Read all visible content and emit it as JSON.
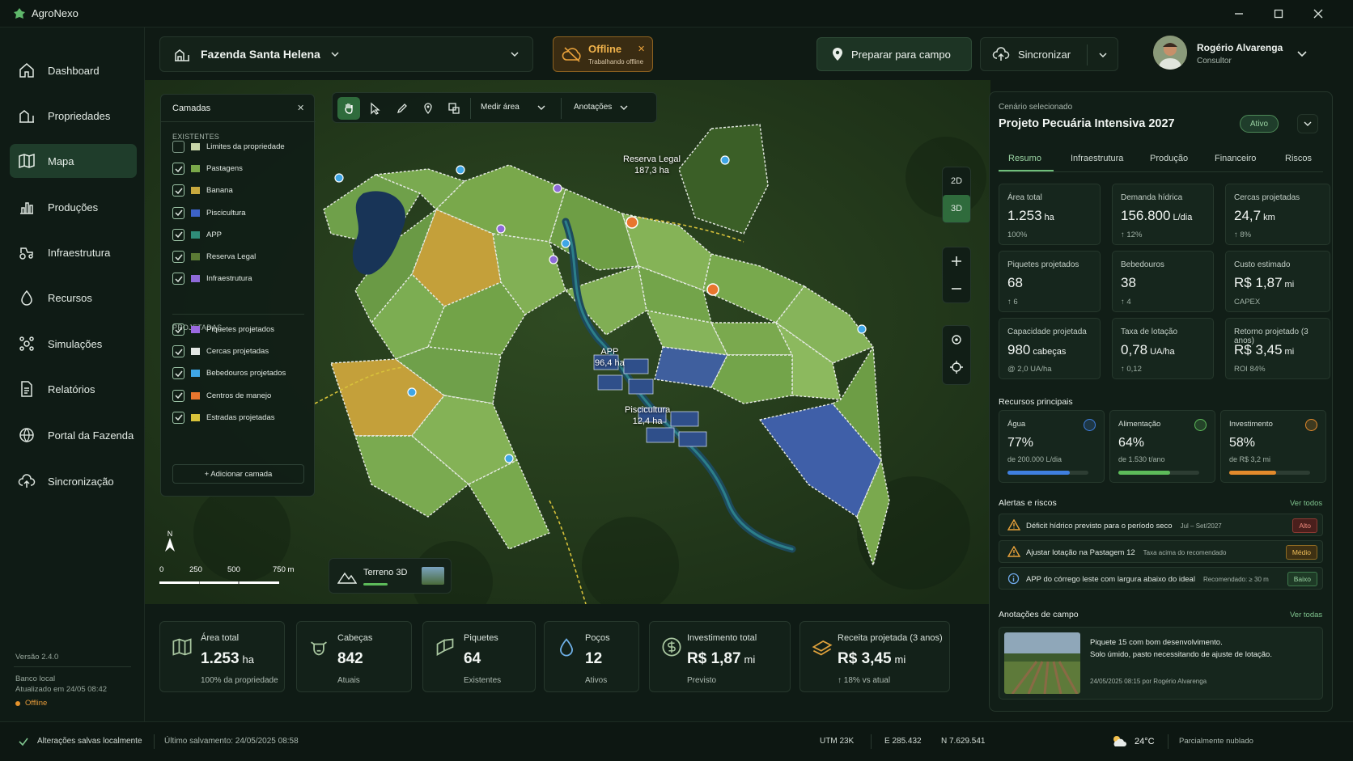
{
  "app": {
    "name": "AgroNexo"
  },
  "sidebar": {
    "items": [
      {
        "label": "Dashboard"
      },
      {
        "label": "Propriedades"
      },
      {
        "label": "Mapa"
      },
      {
        "label": "Produções"
      },
      {
        "label": "Infraestrutura"
      },
      {
        "label": "Recursos"
      },
      {
        "label": "Simulações"
      },
      {
        "label": "Relatórios"
      },
      {
        "label": "Portal da Fazenda"
      },
      {
        "label": "Sincronização"
      }
    ],
    "active": "Mapa",
    "version": "Versão 2.4.0",
    "db_label": "Banco local",
    "db_updated": "Atualizado em 24/05 08:42",
    "status": "Offline"
  },
  "topbar": {
    "farm": "Fazenda Santa Helena",
    "offline_title": "Offline",
    "offline_sub": "Trabalhando offline",
    "prep_button": "Preparar para campo",
    "sync_button": "Sincronizar",
    "user_name": "Rogério Alvarenga",
    "user_role": "Consultor"
  },
  "layers": {
    "title": "Camadas",
    "existing_title": "EXISTENTES",
    "existing": [
      {
        "label": "Limites da propriedade",
        "checked": false,
        "color": "#c8d6a8"
      },
      {
        "label": "Pastagens",
        "checked": true,
        "color": "#7aa84a"
      },
      {
        "label": "Banana",
        "checked": true,
        "color": "#c8a93e"
      },
      {
        "label": "Piscicultura",
        "checked": true,
        "color": "#3d63c8"
      },
      {
        "label": "APP",
        "checked": true,
        "color": "#2f8c79"
      },
      {
        "label": "Reserva Legal",
        "checked": true,
        "color": "#5b7a34"
      },
      {
        "label": "Infraestrutura",
        "checked": true,
        "color": "#8e6ad8"
      }
    ],
    "projected_title": "PROJETADAS",
    "projected": [
      {
        "label": "Piquetes projetados",
        "checked": true,
        "color": "#9b6ae0"
      },
      {
        "label": "Cercas projetadas",
        "checked": true,
        "color": "#e3e7e4"
      },
      {
        "label": "Bebedouros projetados",
        "checked": true,
        "color": "#3fa6e6"
      },
      {
        "label": "Centros de manejo",
        "checked": true,
        "color": "#e8762e"
      },
      {
        "label": "Estradas projetadas",
        "checked": true,
        "color": "#d8c23a"
      }
    ],
    "add_label": "+ Adicionar camada"
  },
  "toolbar": {
    "measure": "Medir área",
    "annotations": "Anotações"
  },
  "map": {
    "labels": {
      "reserva": "Reserva Legal",
      "reserva_area": "187,3 ha",
      "app": "APP",
      "app_area": "96,4 ha",
      "pisc": "Piscicultura",
      "pisc_area": "12,4 ha"
    },
    "view_2d": "2D",
    "view_3d": "3D",
    "north": "N",
    "scale": [
      "0",
      "250",
      "500",
      "750 m"
    ],
    "terrain": "Terreno 3D"
  },
  "stats": [
    {
      "label": "Área total",
      "value": "1.253",
      "unit": "ha",
      "sub": "100% da propriedade",
      "icon": "map-icon"
    },
    {
      "label": "Cabeças",
      "value": "842",
      "unit": "",
      "sub": "Atuais",
      "icon": "cow-icon"
    },
    {
      "label": "Piquetes",
      "value": "64",
      "unit": "",
      "sub": "Existentes",
      "icon": "paddock-icon"
    },
    {
      "label": "Poços",
      "value": "12",
      "unit": "",
      "sub": "Ativos",
      "icon": "drop-icon"
    },
    {
      "label": "Investimento total",
      "value": "R$ 1,87",
      "unit": "mi",
      "sub": "Previsto",
      "icon": "dollar-icon"
    },
    {
      "label": "Receita projetada (3 anos)",
      "value": "R$ 3,45",
      "unit": "mi",
      "sub": "↑ 18% vs atual",
      "icon": "money-icon"
    }
  ],
  "panel": {
    "caption": "Cenário selecionado",
    "title": "Projeto Pecuária Intensiva 2027",
    "status": "Ativo",
    "tabs": [
      "Resumo",
      "Infraestrutura",
      "Produção",
      "Financeiro",
      "Riscos"
    ],
    "kpis": [
      {
        "title": "Área total",
        "value": "1.253",
        "unit": "ha",
        "sub": "100%"
      },
      {
        "title": "Demanda hídrica",
        "value": "156.800",
        "unit": "L/dia",
        "sub": "↑ 12%"
      },
      {
        "title": "Cercas projetadas",
        "value": "24,7",
        "unit": "km",
        "sub": "↑ 8%"
      },
      {
        "title": "Piquetes projetados",
        "value": "68",
        "unit": "",
        "sub": "↑ 6"
      },
      {
        "title": "Bebedouros",
        "value": "38",
        "unit": "",
        "sub": "↑ 4"
      },
      {
        "title": "Custo estimado",
        "value": "R$ 1,87",
        "unit": "mi",
        "sub": "CAPEX"
      },
      {
        "title": "Capacidade projetada",
        "value": "980",
        "unit": "cabeças",
        "sub": "@ 2,0 UA/ha"
      },
      {
        "title": "Taxa de lotação",
        "value": "0,78",
        "unit": "UA/ha",
        "sub": "↑ 0,12"
      },
      {
        "title": "Retorno projetado (3 anos)",
        "value": "R$ 3,45",
        "unit": "mi",
        "sub": "ROI 84%"
      }
    ],
    "resources_title": "Recursos principais",
    "resources": [
      {
        "title": "Água",
        "value": "77%",
        "level": 0.77,
        "sub": "de 200.000 L/dia",
        "color": "#3f7fe0"
      },
      {
        "title": "Alimentação",
        "value": "64%",
        "level": 0.64,
        "sub": "de 1.530 t/ano",
        "color": "#5dbb5a"
      },
      {
        "title": "Investimento",
        "value": "58%",
        "level": 0.58,
        "sub": "de R$ 3,2 mi",
        "color": "#e38a2c"
      }
    ],
    "alerts_title": "Alertas e riscos",
    "alerts_link": "Ver todos",
    "alerts": [
      {
        "text": "Déficit hídrico previsto para o período seco",
        "note": "Jul – Set/2027",
        "badge": "Alto"
      },
      {
        "text": "Ajustar lotação na Pastagem 12",
        "note": "Taxa acima do recomendado",
        "badge": "Médio"
      },
      {
        "text": "APP do córrego leste com largura abaixo do ideal",
        "note": "Recomendado: ≥ 30 m",
        "badge": "Baixo"
      }
    ],
    "notes_title": "Anotações de campo",
    "notes_link": "Ver todas",
    "note": {
      "line1": "Piquete 15 com bom desenvolvimento.",
      "line2": "Solo úmido, pasto necessitando de ajuste de lotação.",
      "meta": "24/05/2025 08:15 por Rogério Alvarenga"
    }
  },
  "statusbar": {
    "saved": "Alterações salvas localmente",
    "last_save": "Último salvamento: 24/05/2025 08:58",
    "utm": "UTM 23K",
    "east": "E 285.432",
    "north": "N 7.629.541",
    "temp": "24°C",
    "weather": "Parcialmente nublado"
  }
}
